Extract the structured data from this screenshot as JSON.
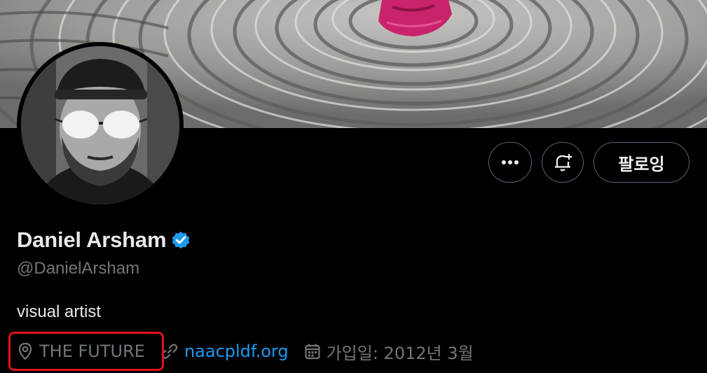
{
  "profile": {
    "display_name": "Daniel Arsham",
    "handle": "@DanielArsham",
    "verified": true,
    "bio": "visual artist",
    "location": "THE FUTURE",
    "website": "naacpldf.org",
    "joined": "가입일: 2012년 3월"
  },
  "actions": {
    "more_icon": "ellipsis-icon",
    "notify_icon": "bell-plus-icon",
    "follow_label": "팔로잉"
  },
  "colors": {
    "background": "#000000",
    "text_primary": "#e7e9ea",
    "text_secondary": "#71767b",
    "link": "#1d9bf0",
    "verified_badge": "#1d9bf0",
    "highlight_box": "#e0101b"
  }
}
